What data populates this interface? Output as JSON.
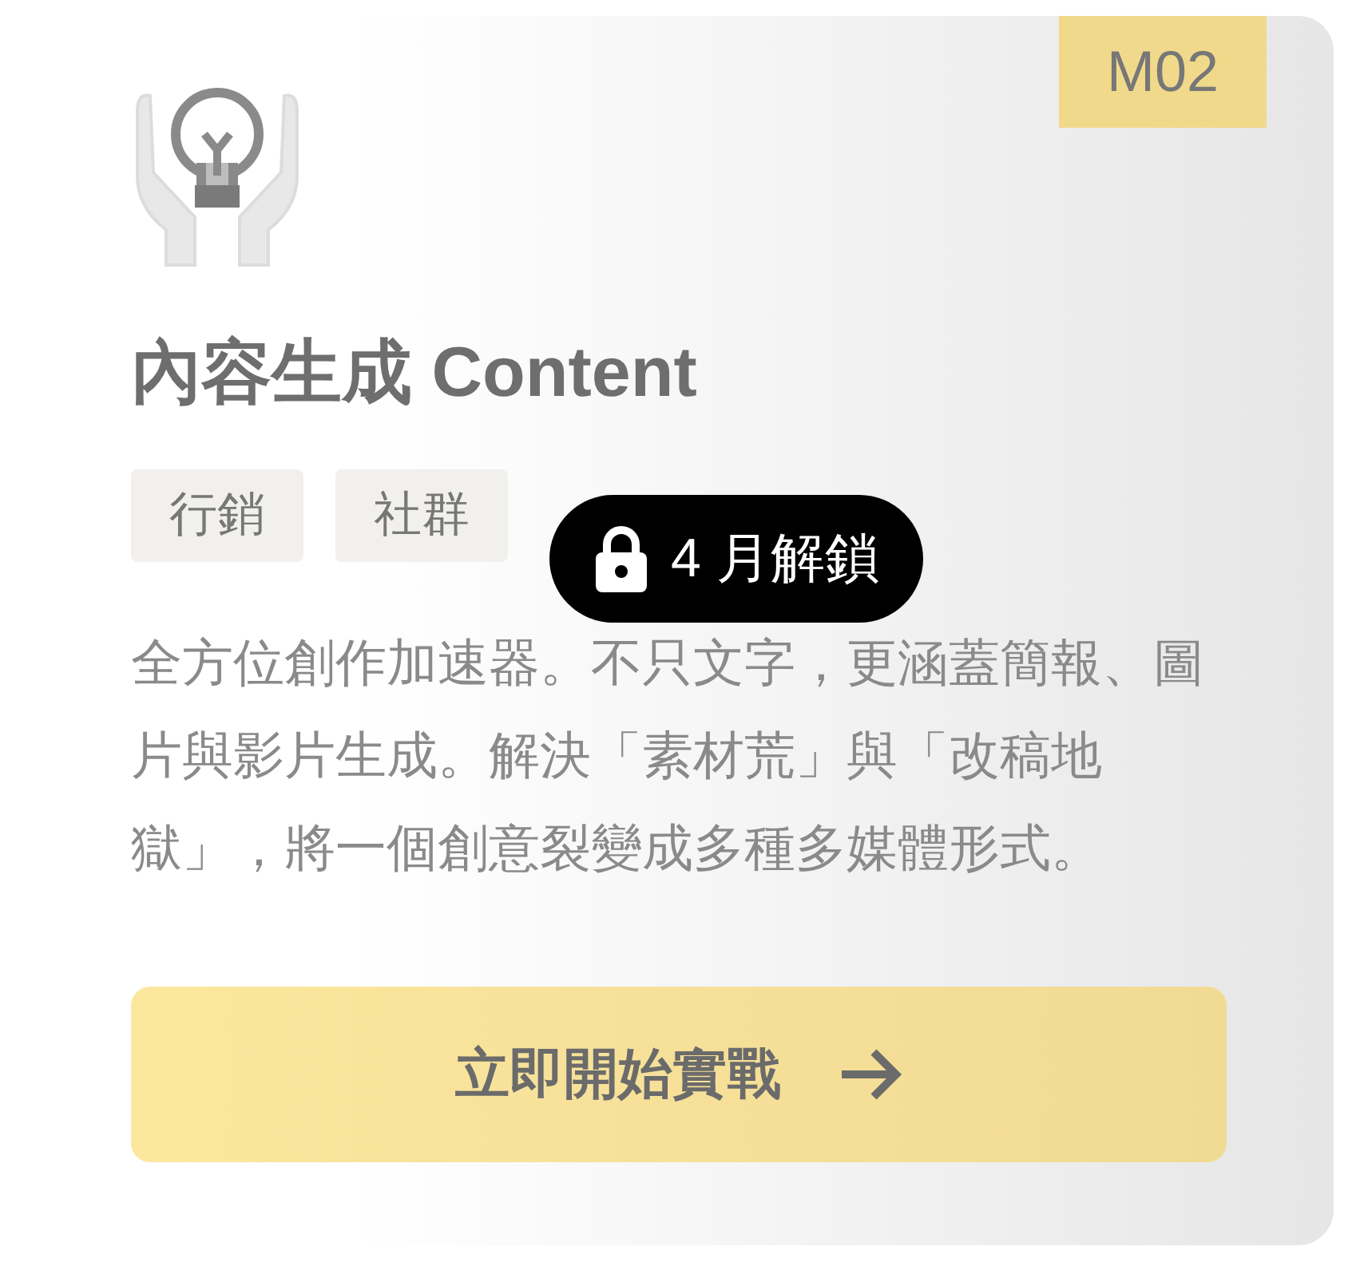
{
  "card": {
    "code": "M02",
    "title": "內容生成 Content",
    "tags": [
      "行銷",
      "社群"
    ],
    "lock_badge": {
      "locked": true,
      "label": "4 月解鎖"
    },
    "description": "全方位創作加速器。不只文字，更涵蓋簡報、圖片與影片生成。解決「素材荒」與「改稿地獄」，將一個創意裂變成多種多媒體形式。",
    "action": {
      "label": "立即開始實戰"
    }
  }
}
